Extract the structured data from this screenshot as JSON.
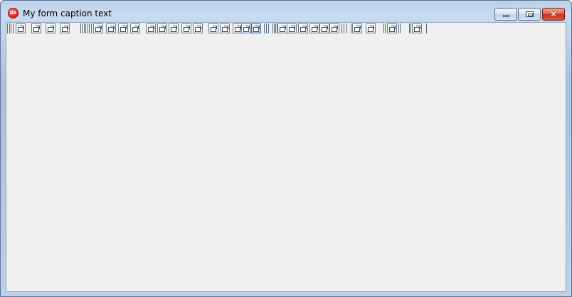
{
  "window": {
    "title": "My form caption text",
    "icon": "dx-app-icon",
    "icon_text": "DX",
    "controls": {
      "minimize_icon": "minimize-icon",
      "maximize_icon": "maximize-icon",
      "close_icon": "close-icon",
      "close_glyph": "✕"
    }
  },
  "toolbar": {
    "icon": "restore-window-icon",
    "button_count": 28,
    "selected_index": 17
  },
  "colors": {
    "frame": "#bcd0e8",
    "client": "#f0f0f0",
    "close_button": "#c4331b"
  }
}
